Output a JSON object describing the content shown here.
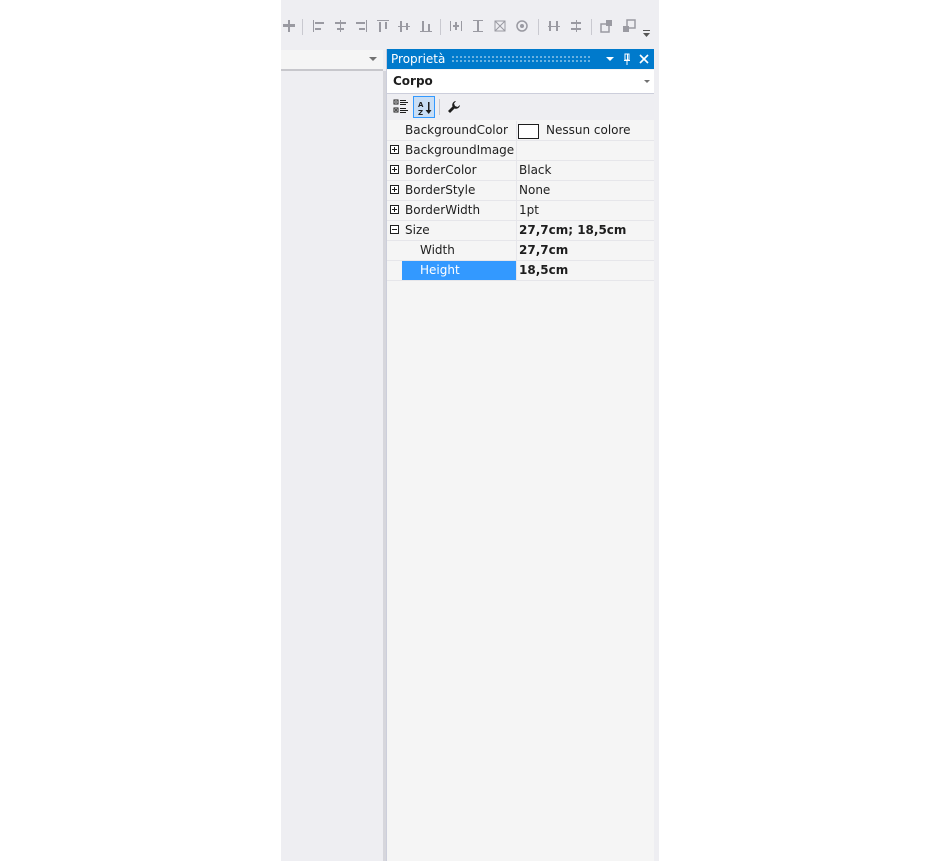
{
  "toolbar": {
    "icons": [
      "align-to-grid-icon",
      "align-lefts-icon",
      "align-centers-icon",
      "align-rights-icon",
      "align-tops-icon",
      "align-middles-icon",
      "align-bottoms-icon",
      "make-same-width-icon",
      "make-same-height-icon",
      "make-same-size-icon",
      "size-to-grid-icon",
      "horizontal-spacing-icon",
      "vertical-spacing-icon",
      "bring-to-front-icon",
      "send-to-back-icon"
    ]
  },
  "properties_panel": {
    "title": "Proprietà",
    "object_selector": "Corpo",
    "toolbar": {
      "categorized_tooltip": "categorized-icon",
      "alphabetical_tooltip": "alphabetical-icon",
      "property_pages_tooltip": "wrench-icon"
    },
    "rows": [
      {
        "name": "BackgroundColor",
        "value": "Nessun colore",
        "expander": "none",
        "color_swatch": "#ffffff",
        "bold": false
      },
      {
        "name": "BackgroundImage",
        "value": "",
        "expander": "plus",
        "bold": false
      },
      {
        "name": "BorderColor",
        "value": "Black",
        "expander": "plus",
        "bold": false
      },
      {
        "name": "BorderStyle",
        "value": "None",
        "expander": "plus",
        "bold": false
      },
      {
        "name": "BorderWidth",
        "value": "1pt",
        "expander": "plus",
        "bold": false
      },
      {
        "name": "Size",
        "value": "27,7cm; 18,5cm",
        "expander": "minus",
        "bold": true
      },
      {
        "name": "Width",
        "value": "27,7cm",
        "expander": "child",
        "bold": true
      },
      {
        "name": "Height",
        "value": "18,5cm",
        "expander": "child",
        "bold": true,
        "selected": true
      }
    ]
  },
  "colors": {
    "accent": "#007acc",
    "selection": "#3399ff"
  }
}
